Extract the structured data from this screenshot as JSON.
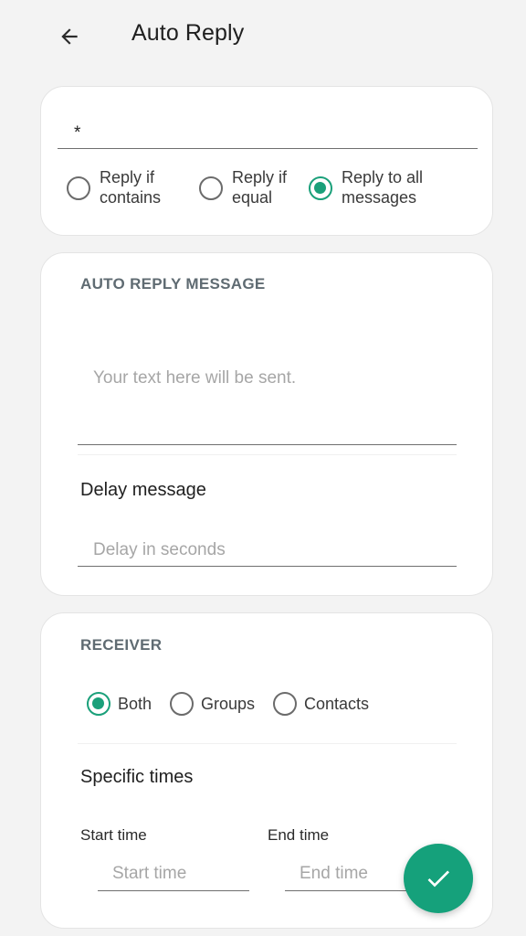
{
  "header": {
    "title": "Auto Reply",
    "back_icon": "arrow-left-icon"
  },
  "trigger": {
    "keyword_value": "*",
    "options": [
      {
        "label": "Reply if contains",
        "checked": false
      },
      {
        "label": "Reply if equal",
        "checked": false
      },
      {
        "label": "Reply to all messages",
        "checked": true
      }
    ]
  },
  "message": {
    "section_title": "AUTO REPLY MESSAGE",
    "message_placeholder": "Your text here will be sent.",
    "delay_label": "Delay message",
    "delay_placeholder": "Delay in seconds"
  },
  "receiver": {
    "section_title": "RECEIVER",
    "options": [
      {
        "label": "Both",
        "checked": true
      },
      {
        "label": "Groups",
        "checked": false
      },
      {
        "label": "Contacts",
        "checked": false
      }
    ],
    "specific_times_label": "Specific times",
    "start_label": "Start time",
    "end_label": "End time",
    "start_placeholder": "Start time",
    "end_placeholder": "End time"
  },
  "fab": {
    "icon": "check-icon"
  },
  "colors": {
    "accent": "#1aa07a",
    "fab": "#15a17b",
    "section_title": "#5f6b72"
  }
}
